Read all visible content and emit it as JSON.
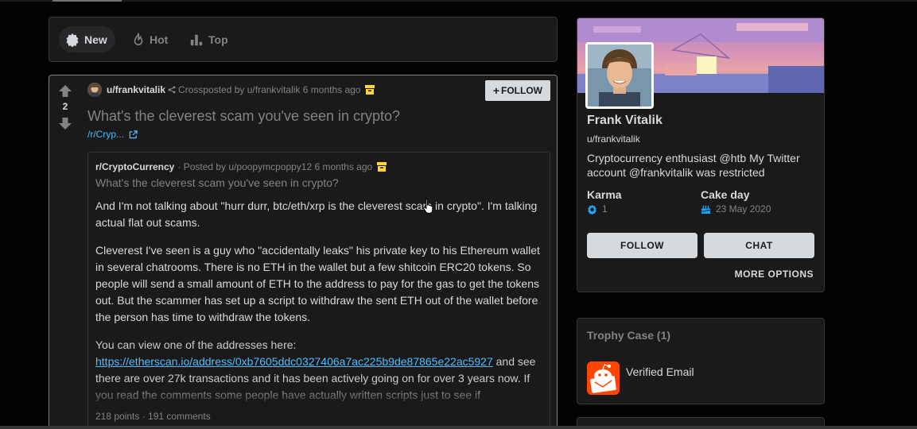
{
  "sort": {
    "new_label": "New",
    "hot_label": "Hot",
    "top_label": "Top"
  },
  "post": {
    "score": "2",
    "author": "u/frankvitalik",
    "crosspost_text": "Crossposted by u/frankvitalik 6 months ago",
    "follow_label": "FOLLOW",
    "title": "What's the cleverest scam you've seen in crypto?",
    "sub_link": "/r/Cryp..."
  },
  "crosspost": {
    "subreddit": "r/CryptoCurrency",
    "posted_by": "· Posted by u/poopymcpoppy12 6 months ago",
    "title": "What's the cleverest scam you've seen in crypto?",
    "para1": "And I'm not talking about \"hurr durr, btc/eth/xrp is the cleverest scam in crypto\". I'm talking actual flat out scams.",
    "para2": "Cleverest I've seen is a guy who \"accidentally leaks\" his private key to his Ethereum wallet in several chatrooms. There is no ETH in the wallet but a few shitcoin ERC20 tokens. So people will send a small amount of ETH to the address to pay for the gas to get the tokens out. But the scammer has set up a script to withdraw the sent ETH out of the wallet before the person has time to withdraw the tokens.",
    "para3_before": "You can view one of the addresses here:",
    "para3_link": "https://etherscan.io/address/0xb7605ddc0327406a7ac225b9de87865e22ac5927",
    "para3_after": " and see there are over 27k transactions and it has been actively going on for over 3 years now. If you read the comments some people have actually written scripts just to see if",
    "footer": "218 points · 191 comments"
  },
  "profile": {
    "name": "Frank Vitalik",
    "username": "u/frankvitalik",
    "bio": "Cryptocurrency enthusiast @htb My Twitter account @frankvitalik was restricted",
    "karma_label": "Karma",
    "karma_value": "1",
    "cakeday_label": "Cake day",
    "cakeday_value": "23 May 2020",
    "follow_label": "FOLLOW",
    "chat_label": "CHAT",
    "more_label": "MORE OPTIONS"
  },
  "trophy": {
    "header": "Trophy Case (1)",
    "item_label": "Verified Email"
  },
  "colors": {
    "accent_link": "#4fbcff",
    "brand_orange": "#ff4500",
    "background": "#030303",
    "card": "#1a1a1b"
  }
}
